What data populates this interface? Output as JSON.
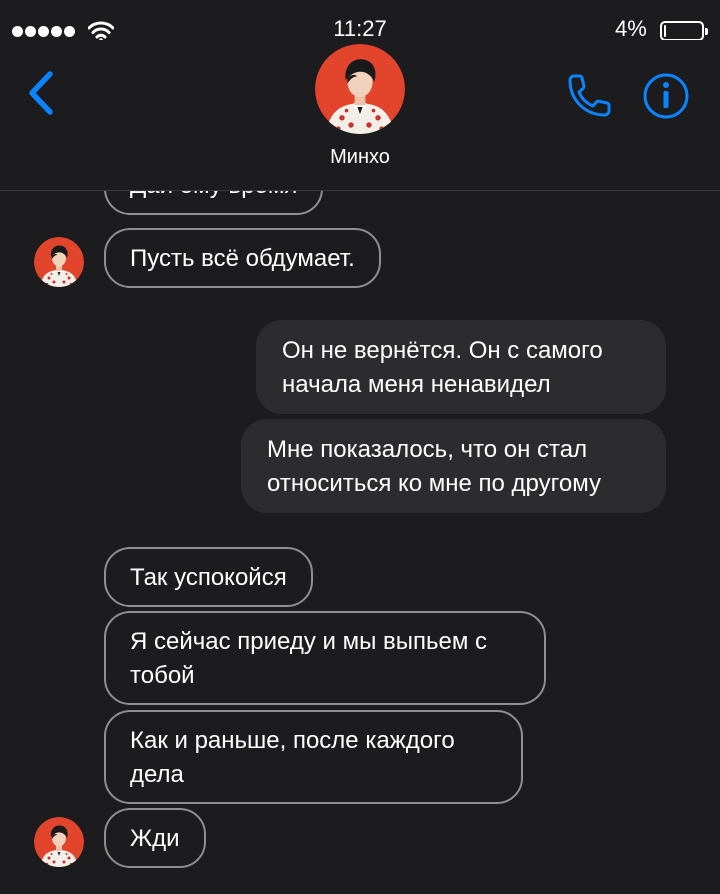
{
  "status_bar": {
    "time": "11:27",
    "battery_percent": "4%",
    "battery_level": 0.04,
    "signal_bars": 5
  },
  "header": {
    "back_icon": "chevron-left-icon",
    "contact_name": "Минхо",
    "call_icon": "phone-icon",
    "info_icon": "info-icon"
  },
  "messages": [
    {
      "direction": "incoming",
      "text": "Дай ему время"
    },
    {
      "direction": "incoming",
      "text": "Пусть всё обдумает."
    },
    {
      "direction": "outgoing",
      "text": "Он не вернётся. Он с самого\nначала меня ненавидел"
    },
    {
      "direction": "outgoing",
      "text": "Мне показалось, что он стал\nотноситься ко мне по другому"
    },
    {
      "direction": "incoming",
      "text": "Так успокойся"
    },
    {
      "direction": "incoming",
      "text": "Я сейчас приеду и мы выпьем с\nтобой"
    },
    {
      "direction": "incoming",
      "text": "Как и раньше, после каждого\nдела"
    },
    {
      "direction": "incoming",
      "text": "Жди"
    }
  ],
  "colors": {
    "background": "#1c1c1e",
    "accent": "#0a84ff",
    "incoming_border": "#8e8e93",
    "outgoing_fill": "#2c2c2e",
    "avatar_red": "#e2452b"
  }
}
